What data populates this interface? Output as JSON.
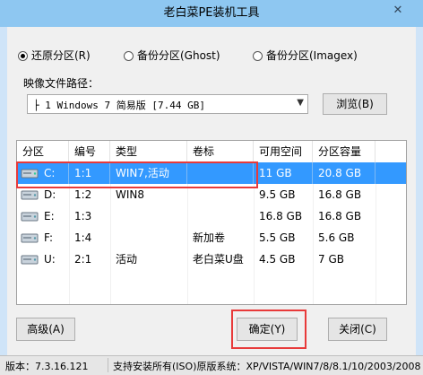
{
  "window": {
    "title": "老白菜PE装机工具",
    "close_glyph": "✕"
  },
  "mode": {
    "options": [
      {
        "label": "还原分区(R)",
        "checked": true
      },
      {
        "label": "备份分区(Ghost)",
        "checked": false
      },
      {
        "label": "备份分区(Imagex)",
        "checked": false
      }
    ]
  },
  "image": {
    "label": "映像文件路径：",
    "selected": "├ 1 Windows 7 简易版 [7.44 GB]",
    "browse_label": "浏览(B)"
  },
  "table": {
    "columns": [
      "分区",
      "编号",
      "类型",
      "卷标",
      "可用空间",
      "分区容量"
    ],
    "rows": [
      {
        "drive": "C:",
        "num": "1:1",
        "type": "WIN7,活动",
        "label": "",
        "free": "11 GB",
        "size": "20.8 GB",
        "selected": true
      },
      {
        "drive": "D:",
        "num": "1:2",
        "type": "WIN8",
        "label": "",
        "free": "9.5 GB",
        "size": "16.8 GB",
        "selected": false
      },
      {
        "drive": "E:",
        "num": "1:3",
        "type": "",
        "label": "",
        "free": "16.8 GB",
        "size": "16.8 GB",
        "selected": false
      },
      {
        "drive": "F:",
        "num": "1:4",
        "type": "",
        "label": "新加卷",
        "free": "5.5 GB",
        "size": "5.6 GB",
        "selected": false
      },
      {
        "drive": "U:",
        "num": "2:1",
        "type": "活动",
        "label": "老白菜U盘",
        "free": "4.5 GB",
        "size": "7 GB",
        "selected": false
      }
    ]
  },
  "buttons": {
    "advanced": "高级(A)",
    "ok": "确定(Y)",
    "close": "关闭(C)"
  },
  "status": {
    "version": "版本：7.3.16.121",
    "systems": "支持安装所有(ISO)原版系统：XP/VISTA/WIN7/8/8.1/10/2003/2008"
  },
  "colors": {
    "titlebar": "#8ec7f1",
    "selection": "#3399ff",
    "highlight": "#e83a3a"
  }
}
